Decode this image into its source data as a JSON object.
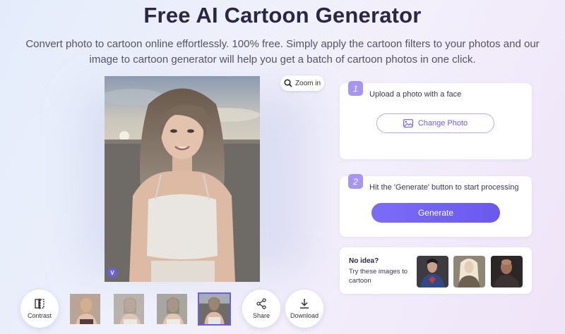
{
  "header": {
    "title": "Free AI Cartoon Generator",
    "subtitle": "Convert photo to cartoon online effortlessly. 100% free. Simply apply the cartoon filters to your photos and our image to cartoon generator will help you get a batch of cartoon photos in one click."
  },
  "preview": {
    "zoom_label": "Zoom in",
    "watermark_label": "V"
  },
  "toolbar": {
    "contrast_label": "Contrast",
    "share_label": "Share",
    "download_label": "Download",
    "selected_thumbnail": 4
  },
  "steps": [
    {
      "number": "1",
      "text": "Upload a photo with a face",
      "button": "Change Photo"
    },
    {
      "number": "2",
      "text": "Hit the 'Generate' button to start processing",
      "button": "Generate"
    }
  ],
  "ideas": {
    "title": "No idea?",
    "text": "Try these images to cartoon"
  },
  "colors": {
    "accent": "#6b5cf0",
    "badge": "#a695f5",
    "title": "#2b2546"
  }
}
